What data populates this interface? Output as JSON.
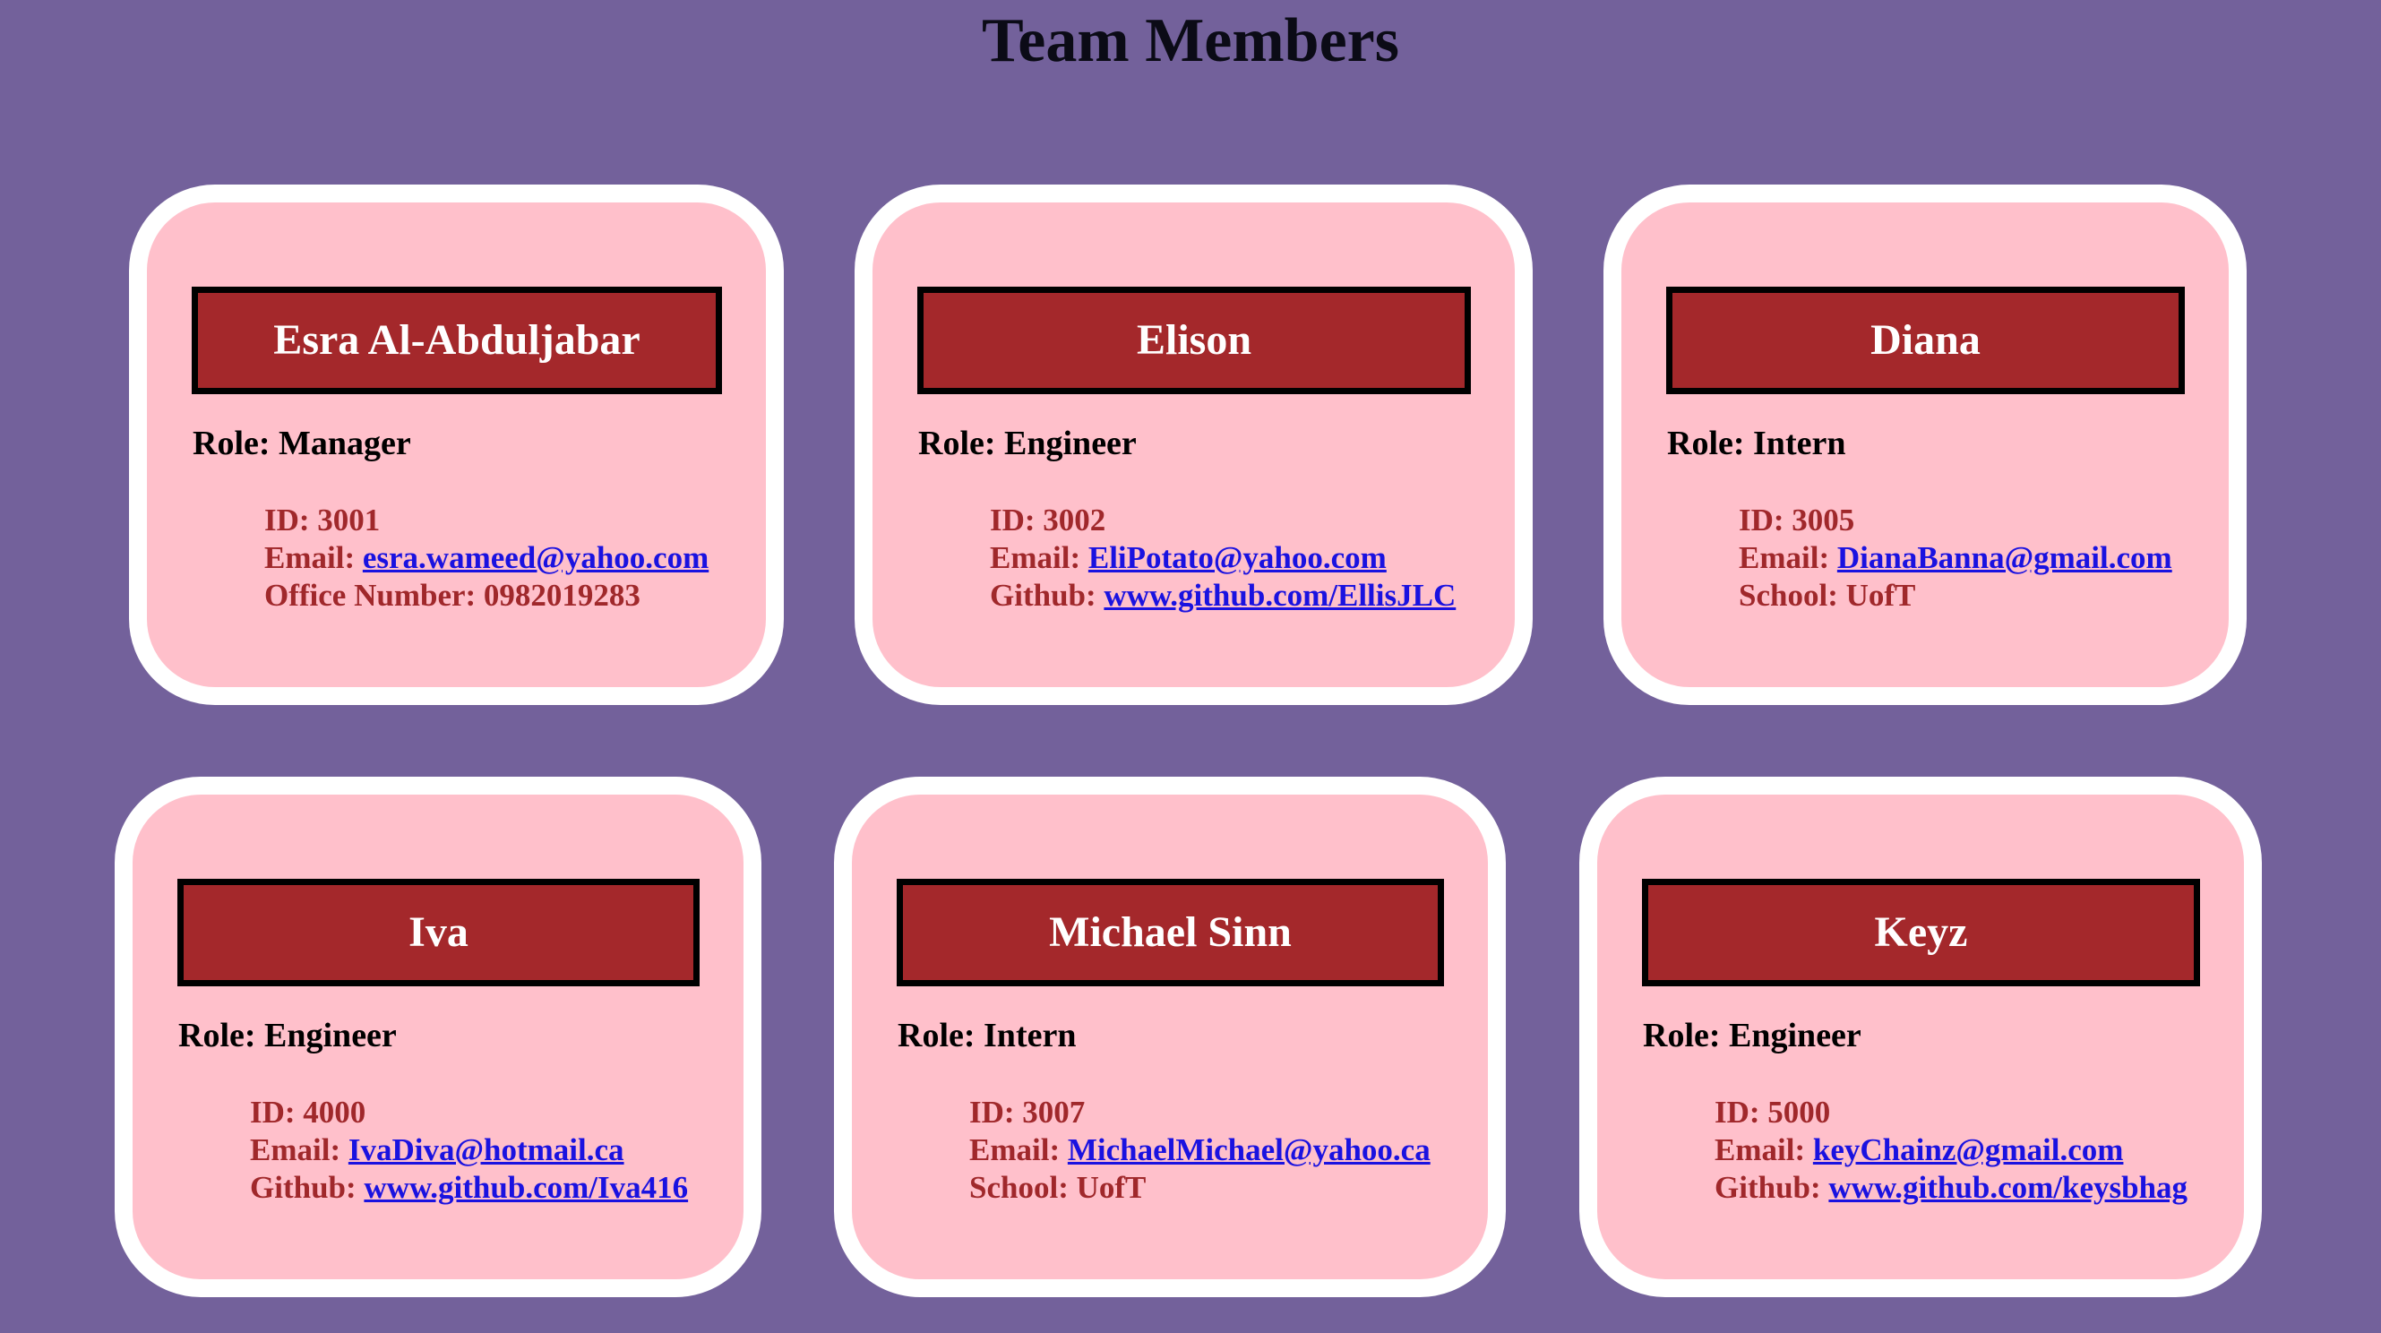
{
  "page": {
    "title": "Team Members"
  },
  "colors": {
    "background": "#73619b",
    "card": "#ffc0cb",
    "card_border": "#ffffff",
    "name_box": "#a4282b",
    "detail_text": "#a0282b",
    "link": "#1a12e0"
  },
  "cards": [
    {
      "name": "Esra Al-Abduljabar",
      "role": "Role: Manager",
      "id": "ID: 3001",
      "email_label": "Email:",
      "email": "esra.wameed@yahoo.com",
      "extra_label": "Office Number:",
      "extra_value": "0982019283"
    },
    {
      "name": "Elison",
      "role": "Role: Engineer",
      "id": "ID: 3002",
      "email_label": "Email:",
      "email": "EliPotato@yahoo.com",
      "extra_label": "Github:",
      "extra_value": "www.github.com/EllisJLC"
    },
    {
      "name": "Diana",
      "role": "Role: Intern",
      "id": "ID: 3005",
      "email_label": "Email:",
      "email": "DianaBanna@gmail.com",
      "extra_label": "School:",
      "extra_value": "UofT"
    },
    {
      "name": "Iva",
      "role": "Role: Engineer",
      "id": "ID: 4000",
      "email_label": "Email:",
      "email": "IvaDiva@hotmail.ca",
      "extra_label": "Github:",
      "extra_value": "www.github.com/Iva416"
    },
    {
      "name": "Michael Sinn",
      "role": "Role: Intern",
      "id": "ID: 3007",
      "email_label": "Email:",
      "email": "MichaelMichael@yahoo.ca",
      "extra_label": "School:",
      "extra_value": "UofT"
    },
    {
      "name": "Keyz",
      "role": "Role: Engineer",
      "id": "ID: 5000",
      "email_label": "Email:",
      "email": "keyChainz@gmail.com",
      "extra_label": "Github:",
      "extra_value": "www.github.com/keysbhag"
    }
  ]
}
